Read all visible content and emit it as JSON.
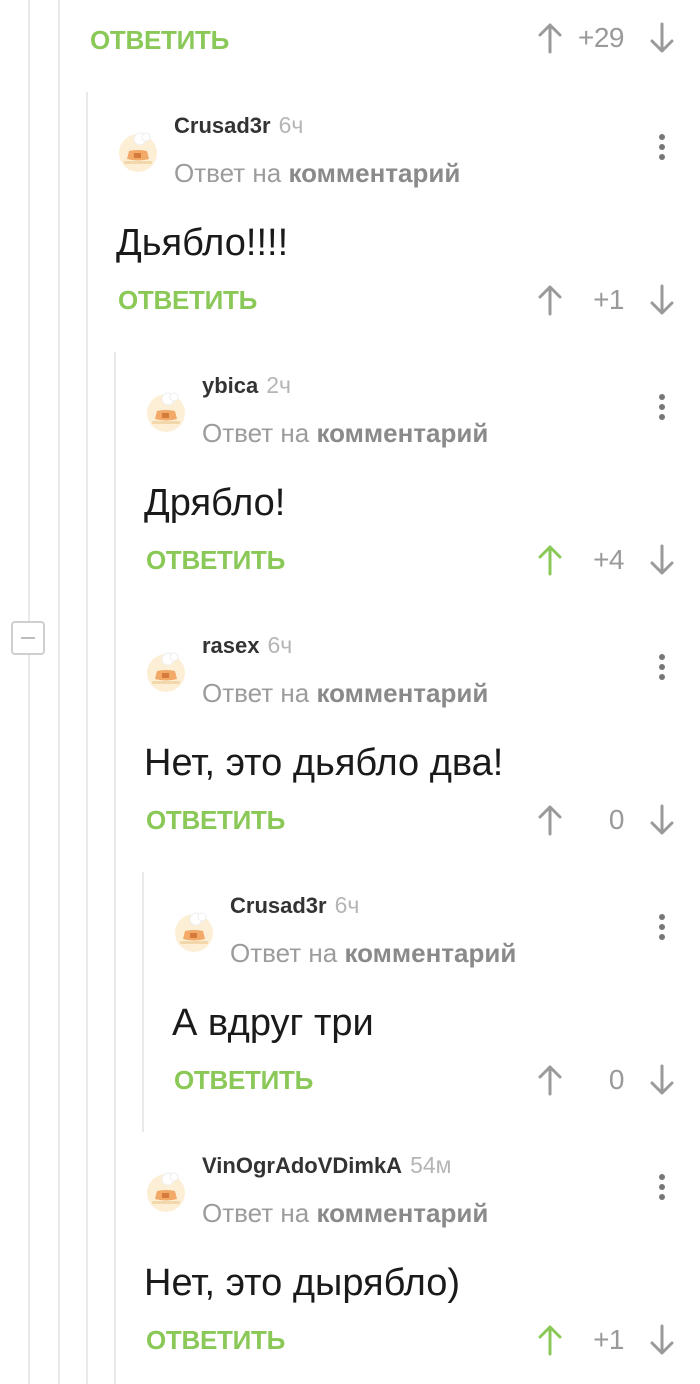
{
  "colors": {
    "accent_green": "#8ac858",
    "score_gray": "#9a9a9a"
  },
  "top_reply": {
    "reply_label": "ОТВЕТИТЬ",
    "score": "+29",
    "upvoted": false
  },
  "collapse_icon": "minus-box-icon",
  "comments": [
    {
      "author": "Crusad3r",
      "time": "6ч",
      "reply_to_prefix": "Ответ на",
      "reply_to_link": "комментарий",
      "text": "Дьябло!!!!",
      "reply_label": "ОТВЕТИТЬ",
      "score": "+1",
      "upvoted": false
    },
    {
      "author": "ybica",
      "time": "2ч",
      "reply_to_prefix": "Ответ на",
      "reply_to_link": "комментарий",
      "text": "Дрябло!",
      "reply_label": "ОТВЕТИТЬ",
      "score": "+4",
      "upvoted": true
    },
    {
      "author": "rasex",
      "time": "6ч",
      "reply_to_prefix": "Ответ на",
      "reply_to_link": "комментарий",
      "text": "Нет, это дьябло два!",
      "reply_label": "ОТВЕТИТЬ",
      "score": "0",
      "upvoted": false
    },
    {
      "author": "Crusad3r",
      "time": "6ч",
      "reply_to_prefix": "Ответ на",
      "reply_to_link": "комментарий",
      "text": "А вдруг три",
      "reply_label": "ОТВЕТИТЬ",
      "score": "0",
      "upvoted": false
    },
    {
      "author": "VinOgrAdoVDimkA",
      "time": "54м",
      "reply_to_prefix": "Ответ на",
      "reply_to_link": "комментарий",
      "text": "Нет, это дырябло)",
      "reply_label": "ОТВЕТИТЬ",
      "score": "+1",
      "upvoted": true
    }
  ]
}
